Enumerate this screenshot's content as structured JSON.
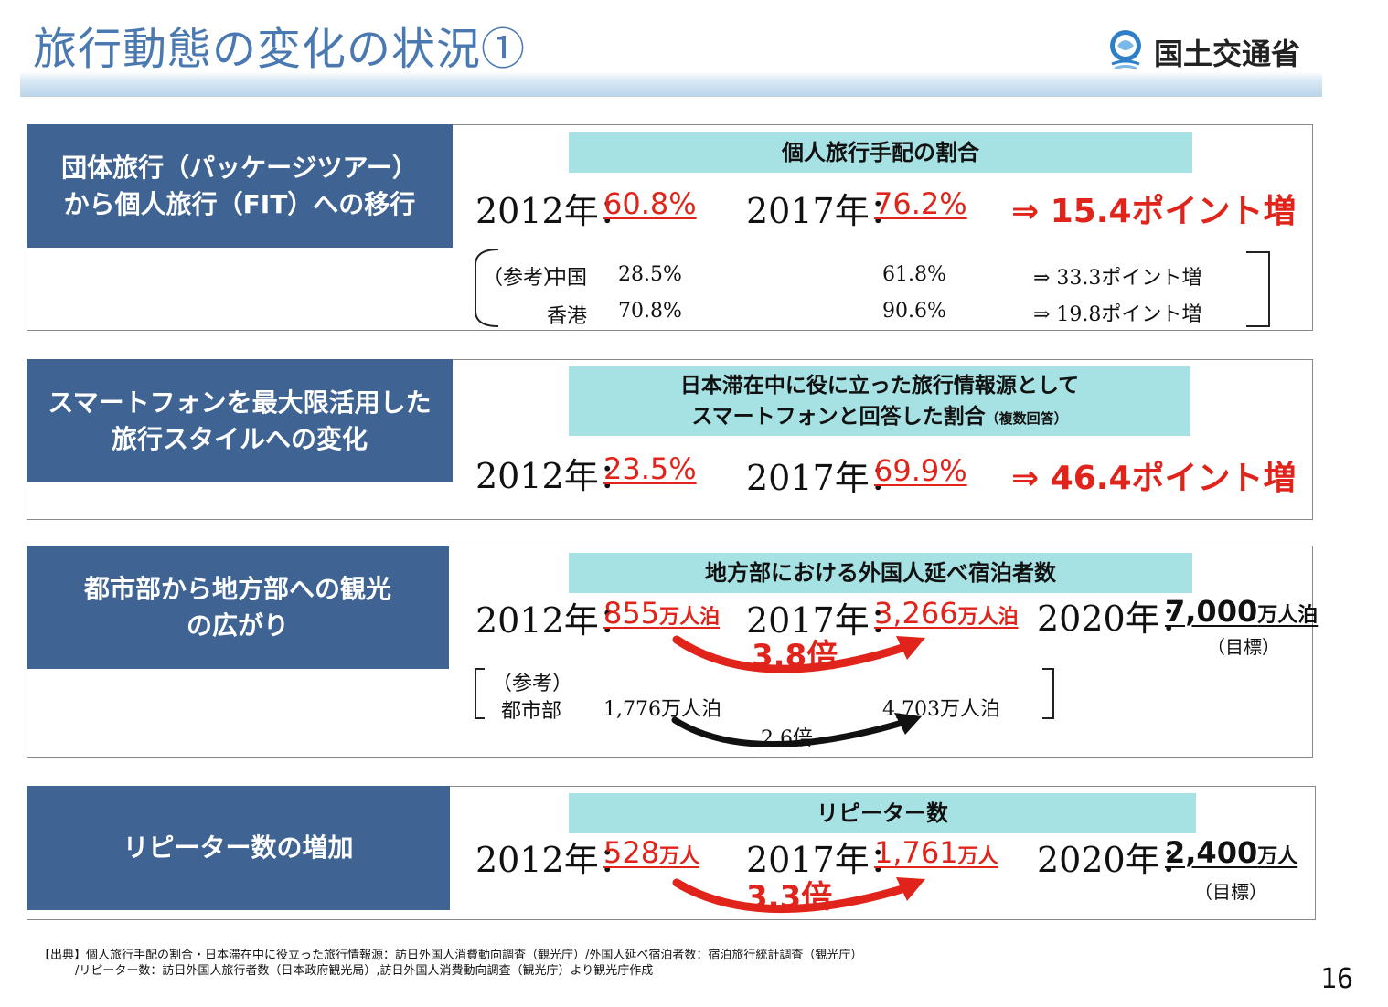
{
  "header": {
    "title": "旅行動態の変化の状況①",
    "org_name": "国土交通省"
  },
  "s1": {
    "label_line1": "団体旅行（パッケージツアー）",
    "label_line2": "から個人旅行（FIT）への移行",
    "caption": "個人旅行手配の割合",
    "y1": "2012年：",
    "v1": "60.8%",
    "y2": "2017年：",
    "v2": "76.2%",
    "increase": "⇒ 15.4ポイント増",
    "ref_label": "（参考）",
    "rows": [
      {
        "region": "中国",
        "a": "28.5%",
        "b": "61.8%",
        "diff": "⇒ 33.3ポイント増"
      },
      {
        "region": "香港",
        "a": "70.8%",
        "b": "90.6%",
        "diff": "⇒ 19.8ポイント増"
      }
    ]
  },
  "s2": {
    "label_line1": "スマートフォンを最大限活用した",
    "label_line2": "旅行スタイルへの変化",
    "caption_line1": "日本滞在中に役に立った旅行情報源として",
    "caption_line2": "スマートフォンと回答した割合",
    "caption_note": "（複数回答）",
    "y1": "2012年：",
    "v1": "23.5%",
    "y2": "2017年：",
    "v2": "69.9%",
    "increase": "⇒ 46.4ポイント増"
  },
  "s3": {
    "label_line1": "都市部から地方部への観光",
    "label_line2": "の広がり",
    "caption": "地方部における外国人延べ宿泊者数",
    "y1": "2012年：",
    "v1": "855",
    "u1": "万人泊",
    "y2": "2017年：",
    "v2": "3,266",
    "u2": "万人泊",
    "y3": "2020年：",
    "v3": "7,000",
    "u3": "万人泊",
    "target_note": "（目標）",
    "multiplier": "3.8倍",
    "ref_label": "（参考）",
    "ref_region": "都市部",
    "ref_a": "1,776万人泊",
    "ref_b": "4,703万人泊",
    "ref_multiplier": "2.6倍"
  },
  "s4": {
    "label": "リピーター数の増加",
    "caption": "リピーター数",
    "y1": "2012年：",
    "v1": "528",
    "u1": "万人",
    "y2": "2017年：",
    "v2": "1,761",
    "u2": "万人",
    "y3": "2020年：",
    "v3": "2,400",
    "u3": "万人",
    "target_note": "（目標）",
    "multiplier": "3.3倍"
  },
  "footer": {
    "source_line1": "【出典】個人旅行手配の割合・日本滞在中に役立った旅行情報源：訪日外国人消費動向調査（観光庁）/外国人延べ宿泊者数：宿泊旅行統計調査（観光庁）",
    "source_line2": "/リピーター数：訪日外国人旅行者数（日本政府観光局）,訪日外国人消費動向調査（観光庁）より観光庁作成",
    "page_number": "16"
  },
  "colors": {
    "title": "#4a78b0",
    "label_bg": "#3f6392",
    "caption_bg": "#a6e1e3",
    "accent_red": "#e0241b"
  }
}
